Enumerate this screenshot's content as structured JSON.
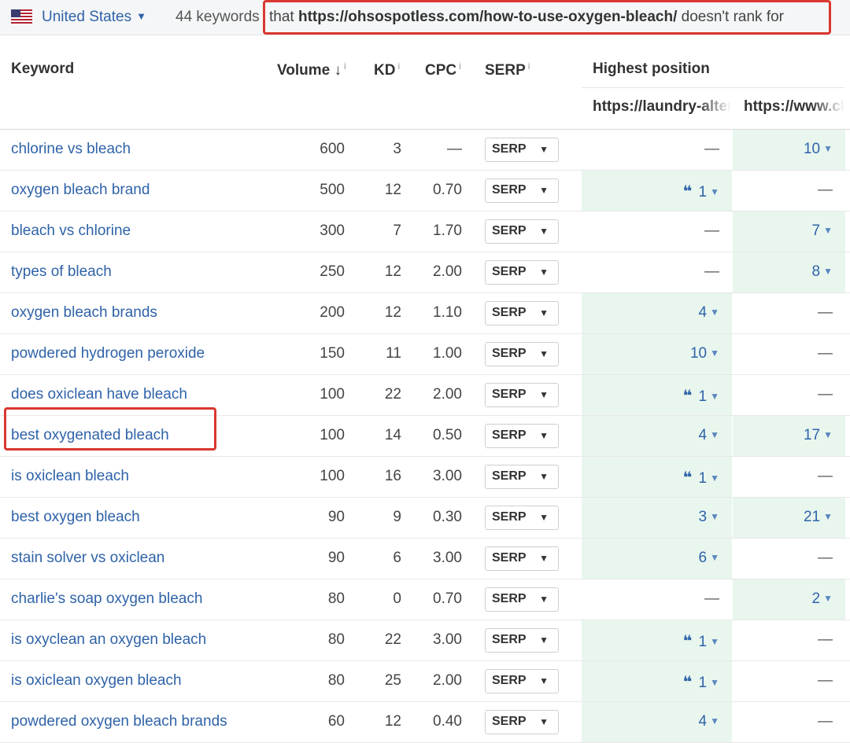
{
  "filter": {
    "country": "United States",
    "keyword_count": "44 keywords",
    "phrase_prefix": "that",
    "phrase_url": "https://ohsospotless.com/how-to-use-oxygen-bleach/",
    "phrase_suffix": "doesn't rank for"
  },
  "columns": {
    "keyword": "Keyword",
    "volume": "Volume",
    "volume_sort": "↓",
    "kd": "KD",
    "cpc": "CPC",
    "serp": "SERP",
    "info": "i",
    "highest_position": "Highest position",
    "competitor_a": "https://laundry-alter",
    "competitor_b": "https://www.cl"
  },
  "rows": [
    {
      "keyword": "chlorine vs bleach",
      "volume": "600",
      "kd": "3",
      "cpc": "—",
      "serp": "SERP",
      "pos_a": "—",
      "pos_a_snippet": false,
      "pos_b": "10",
      "pos_b_snippet": false
    },
    {
      "keyword": "oxygen bleach brand",
      "volume": "500",
      "kd": "12",
      "cpc": "0.70",
      "serp": "SERP",
      "pos_a": "1",
      "pos_a_snippet": true,
      "pos_b": "—",
      "pos_b_snippet": false
    },
    {
      "keyword": "bleach vs chlorine",
      "volume": "300",
      "kd": "7",
      "cpc": "1.70",
      "serp": "SERP",
      "pos_a": "—",
      "pos_a_snippet": false,
      "pos_b": "7",
      "pos_b_snippet": false
    },
    {
      "keyword": "types of bleach",
      "volume": "250",
      "kd": "12",
      "cpc": "2.00",
      "serp": "SERP",
      "pos_a": "—",
      "pos_a_snippet": false,
      "pos_b": "8",
      "pos_b_snippet": false
    },
    {
      "keyword": "oxygen bleach brands",
      "volume": "200",
      "kd": "12",
      "cpc": "1.10",
      "serp": "SERP",
      "pos_a": "4",
      "pos_a_snippet": false,
      "pos_b": "—",
      "pos_b_snippet": false
    },
    {
      "keyword": "powdered hydrogen peroxide",
      "volume": "150",
      "kd": "11",
      "cpc": "1.00",
      "serp": "SERP",
      "pos_a": "10",
      "pos_a_snippet": false,
      "pos_b": "—",
      "pos_b_snippet": false
    },
    {
      "keyword": "does oxiclean have bleach",
      "volume": "100",
      "kd": "22",
      "cpc": "2.00",
      "serp": "SERP",
      "pos_a": "1",
      "pos_a_snippet": true,
      "pos_b": "—",
      "pos_b_snippet": false
    },
    {
      "keyword": "best oxygenated bleach",
      "volume": "100",
      "kd": "14",
      "cpc": "0.50",
      "serp": "SERP",
      "pos_a": "4",
      "pos_a_snippet": false,
      "pos_b": "17",
      "pos_b_snippet": false
    },
    {
      "keyword": "is oxiclean bleach",
      "volume": "100",
      "kd": "16",
      "cpc": "3.00",
      "serp": "SERP",
      "pos_a": "1",
      "pos_a_snippet": true,
      "pos_b": "—",
      "pos_b_snippet": false
    },
    {
      "keyword": "best oxygen bleach",
      "volume": "90",
      "kd": "9",
      "cpc": "0.30",
      "serp": "SERP",
      "pos_a": "3",
      "pos_a_snippet": false,
      "pos_b": "21",
      "pos_b_snippet": false
    },
    {
      "keyword": "stain solver vs oxiclean",
      "volume": "90",
      "kd": "6",
      "cpc": "3.00",
      "serp": "SERP",
      "pos_a": "6",
      "pos_a_snippet": false,
      "pos_b": "—",
      "pos_b_snippet": false
    },
    {
      "keyword": "charlie's soap oxygen bleach",
      "volume": "80",
      "kd": "0",
      "cpc": "0.70",
      "serp": "SERP",
      "pos_a": "—",
      "pos_a_snippet": false,
      "pos_b": "2",
      "pos_b_snippet": false
    },
    {
      "keyword": "is oxyclean an oxygen bleach",
      "volume": "80",
      "kd": "22",
      "cpc": "3.00",
      "serp": "SERP",
      "pos_a": "1",
      "pos_a_snippet": true,
      "pos_b": "—",
      "pos_b_snippet": false
    },
    {
      "keyword": "is oxiclean oxygen bleach",
      "volume": "80",
      "kd": "25",
      "cpc": "2.00",
      "serp": "SERP",
      "pos_a": "1",
      "pos_a_snippet": true,
      "pos_b": "—",
      "pos_b_snippet": false
    },
    {
      "keyword": "powdered oxygen bleach brands",
      "volume": "60",
      "kd": "12",
      "cpc": "0.40",
      "serp": "SERP",
      "pos_a": "4",
      "pos_a_snippet": false,
      "pos_b": "—",
      "pos_b_snippet": false
    }
  ],
  "icons": {
    "flag": "us-flag-icon",
    "caret": "chevron-down-icon",
    "snippet": "featured-snippet-quote-icon",
    "position_caret": "triangle-down-icon"
  },
  "colors": {
    "link": "#2f63a8",
    "highlight": "#e8f6ee",
    "annotation_red": "#d9372f"
  }
}
